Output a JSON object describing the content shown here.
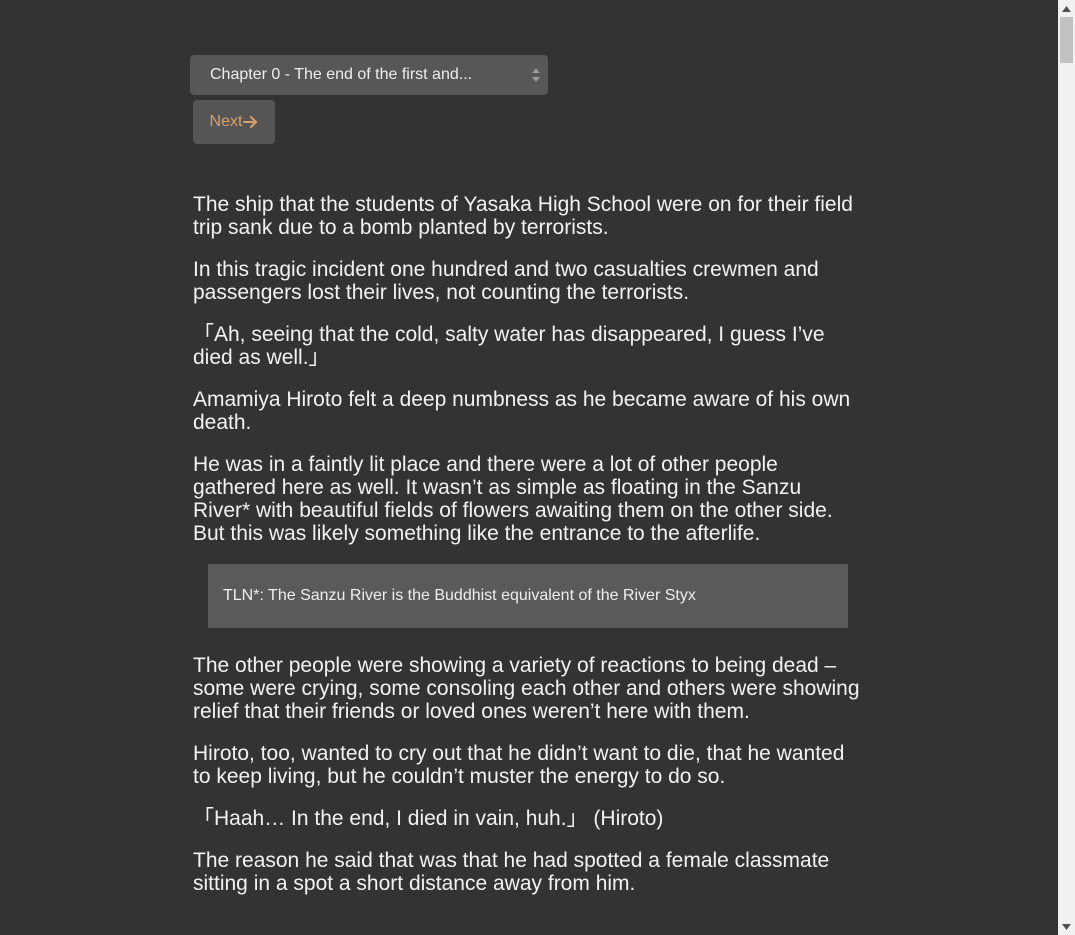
{
  "chapter_select": {
    "selected": "Chapter 0 - The end of the first and..."
  },
  "nav": {
    "next_label": "Next"
  },
  "paragraphs_a": [
    "The ship that the students of Yasaka High School were on for their field trip sank due to a bomb planted by terrorists.",
    "In this tragic incident one hundred and two casualties crewmen and passengers lost their lives, not counting the terrorists.",
    "「Ah, seeing that the cold, salty water has disappeared, I guess I’ve died as well.」",
    "Amamiya Hiroto felt a deep numbness as he became aware of his own death.",
    "He was in a faintly lit place and there were a lot of other people gathered here as well. It wasn’t as simple as floating in the Sanzu River* with beautiful fields of flowers awaiting them on the other side. But this was likely something like the entrance to the afterlife."
  ],
  "tln_note": "TLN*: The Sanzu River is the Buddhist equivalent of the River Styx",
  "paragraphs_b": [
    "The other people were showing a variety of reactions to being dead – some were crying, some consoling each other and others were showing relief that their friends or loved ones weren’t here with them.",
    "Hiroto, too, wanted to cry out that he didn’t want to die, that he wanted to keep living, but he couldn’t muster the energy to do so.",
    "「Haah… In the end, I died in vain, huh.」 (Hiroto)",
    "The reason he said that was that he had spotted a female classmate sitting in a spot a short distance away from him."
  ],
  "colors": {
    "background": "#333333",
    "text": "#f2f2f2",
    "next_accent": "#d9a066",
    "note_box": "#5a5a5a"
  },
  "icons": {
    "select": "select-arrows-icon",
    "next": "arrow-right-icon"
  }
}
